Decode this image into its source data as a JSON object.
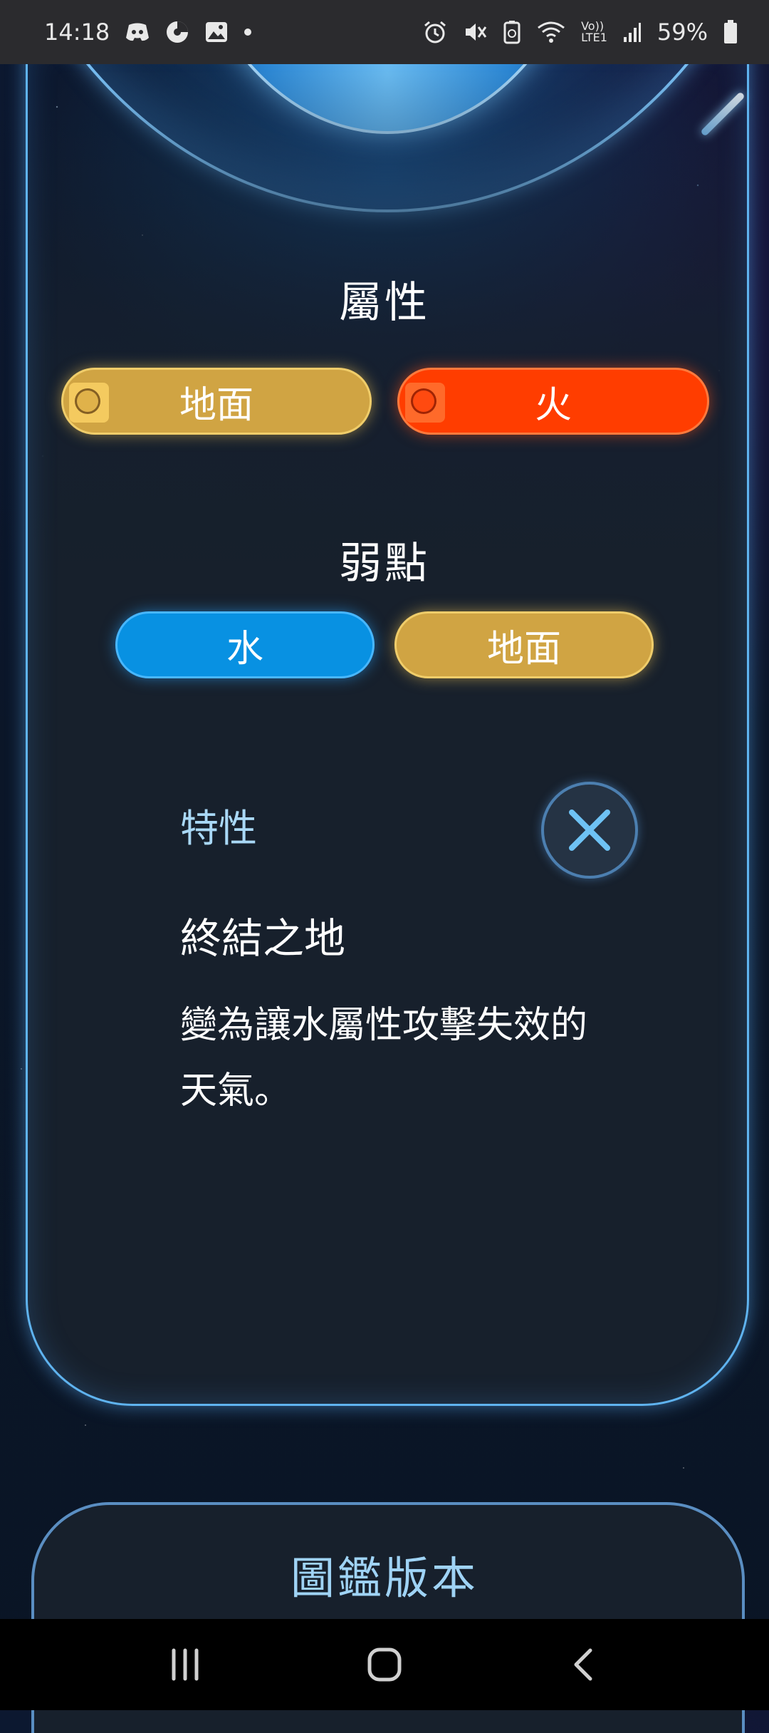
{
  "status_bar": {
    "time": "14:18",
    "battery_percent": "59%",
    "left_icons": [
      "discord-icon",
      "media-icon",
      "gallery-icon",
      "dot-icon"
    ],
    "right_icons": [
      "alarm-icon",
      "vibrate-mute-icon",
      "battery-saver-icon",
      "wifi-icon",
      "volte-lte-icon",
      "signal-icon",
      "battery-icon"
    ],
    "network_label_top": "Vo))",
    "network_label_bottom": "LTE1"
  },
  "types_section": {
    "title": "屬性",
    "types": [
      {
        "label": "地面",
        "color": "#d0a443",
        "icon": "ground-type-icon"
      },
      {
        "label": "火",
        "color": "#ff3d00",
        "icon": "fire-type-icon"
      }
    ]
  },
  "weakness_section": {
    "title": "弱點",
    "types": [
      {
        "label": "水",
        "color": "#0891e2"
      },
      {
        "label": "地面",
        "color": "#d0a443"
      }
    ]
  },
  "ability": {
    "label": "特性",
    "name": "終結之地",
    "description": "變為讓水屬性攻擊失效的天氣。"
  },
  "close_icon": "close-icon",
  "dex_version": {
    "title": "圖鑑版本"
  },
  "nav_bar": {
    "buttons": [
      "recent-apps-icon",
      "home-icon",
      "back-icon"
    ]
  },
  "colors": {
    "accent_blue": "#5fb3ef",
    "card_background": "#17202c",
    "label_blue": "#a9d8f6"
  }
}
